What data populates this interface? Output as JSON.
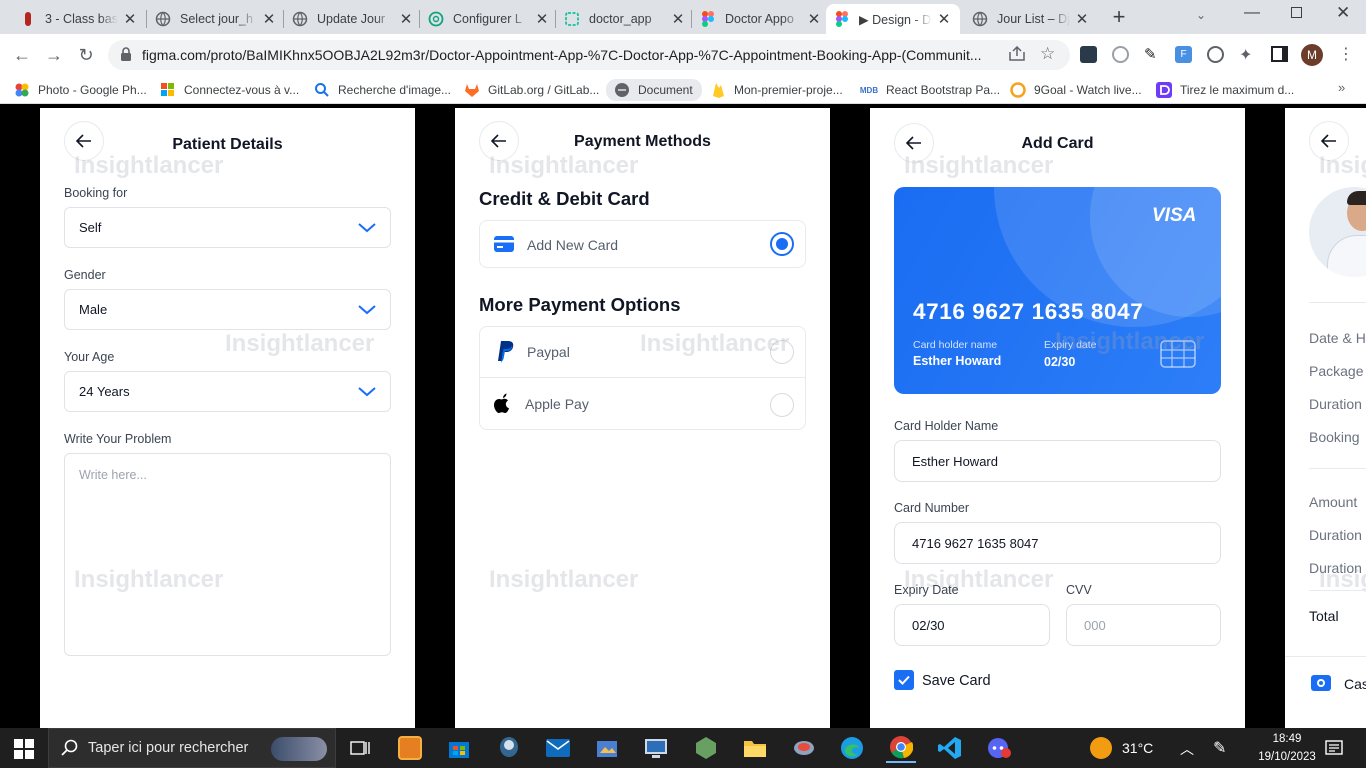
{
  "browser": {
    "tabs": [
      {
        "title": "3 - Class bas"
      },
      {
        "title": "Select jour_h"
      },
      {
        "title": "Update Jour"
      },
      {
        "title": "Configurer L"
      },
      {
        "title": "doctor_app"
      },
      {
        "title": "Doctor Appo"
      },
      {
        "title": "▶ Design - D"
      },
      {
        "title": "Jour List – Dj"
      }
    ],
    "url": "figma.com/proto/BaIMIKhnx5OOBJA2L92m3r/Doctor-Appointment-App-%7C-Doctor-App-%7C-Appointment-Booking-App-(Communit...",
    "profile_initial": "M",
    "bookmarks": [
      {
        "label": "Photo - Google Ph..."
      },
      {
        "label": "Connectez-vous à v..."
      },
      {
        "label": "Recherche d'image..."
      },
      {
        "label": "GitLab.org / GitLab..."
      },
      {
        "label": "Document"
      },
      {
        "label": "Mon-premier-proje..."
      },
      {
        "label": "React Bootstrap Pa..."
      },
      {
        "label": "9Goal - Watch live..."
      },
      {
        "label": "Tirez le maximum d..."
      }
    ]
  },
  "watermark": "Insightlancer",
  "patient": {
    "title": "Patient Details",
    "booking_label": "Booking for",
    "booking_value": "Self",
    "gender_label": "Gender",
    "gender_value": "Male",
    "age_label": "Your Age",
    "age_value": "24 Years",
    "problem_label": "Write Your Problem",
    "problem_placeholder": "Write here..."
  },
  "payment": {
    "title": "Payment Methods",
    "section1": "Credit & Debit Card",
    "add_card": "Add New Card",
    "section2": "More Payment Options",
    "paypal": "Paypal",
    "applepay": "Apple Pay"
  },
  "addcard": {
    "title": "Add Card",
    "card_brand": "VISA",
    "card_number": "4716 9627 1635 8047",
    "holder_caption": "Card holder name",
    "holder_name": "Esther Howard",
    "expiry_caption": "Expiry date",
    "expiry": "02/30",
    "holder_label": "Card Holder Name",
    "holder_value": "Esther Howard",
    "number_label": "Card Number",
    "number_value": "4716 9627 1635 8047",
    "expiry_label": "Expiry Date",
    "expiry_value": "02/30",
    "cvv_label": "CVV",
    "cvv_placeholder": "000",
    "save_label": "Save Card"
  },
  "summary": {
    "rows": [
      "Date & H",
      "Package",
      "Duration",
      "Booking",
      "Amount",
      "Duration",
      "Duration",
      "Total"
    ],
    "cash_label": "Cas"
  },
  "taskbar": {
    "search_placeholder": "Taper ici pour rechercher",
    "temperature": "31°C",
    "time": "18:49",
    "date": "19/10/2023"
  },
  "colors": {
    "primary": "#1a6ef5",
    "card_gradient_start": "#1a6cf2",
    "card_gradient_end": "#2d7ef7"
  }
}
